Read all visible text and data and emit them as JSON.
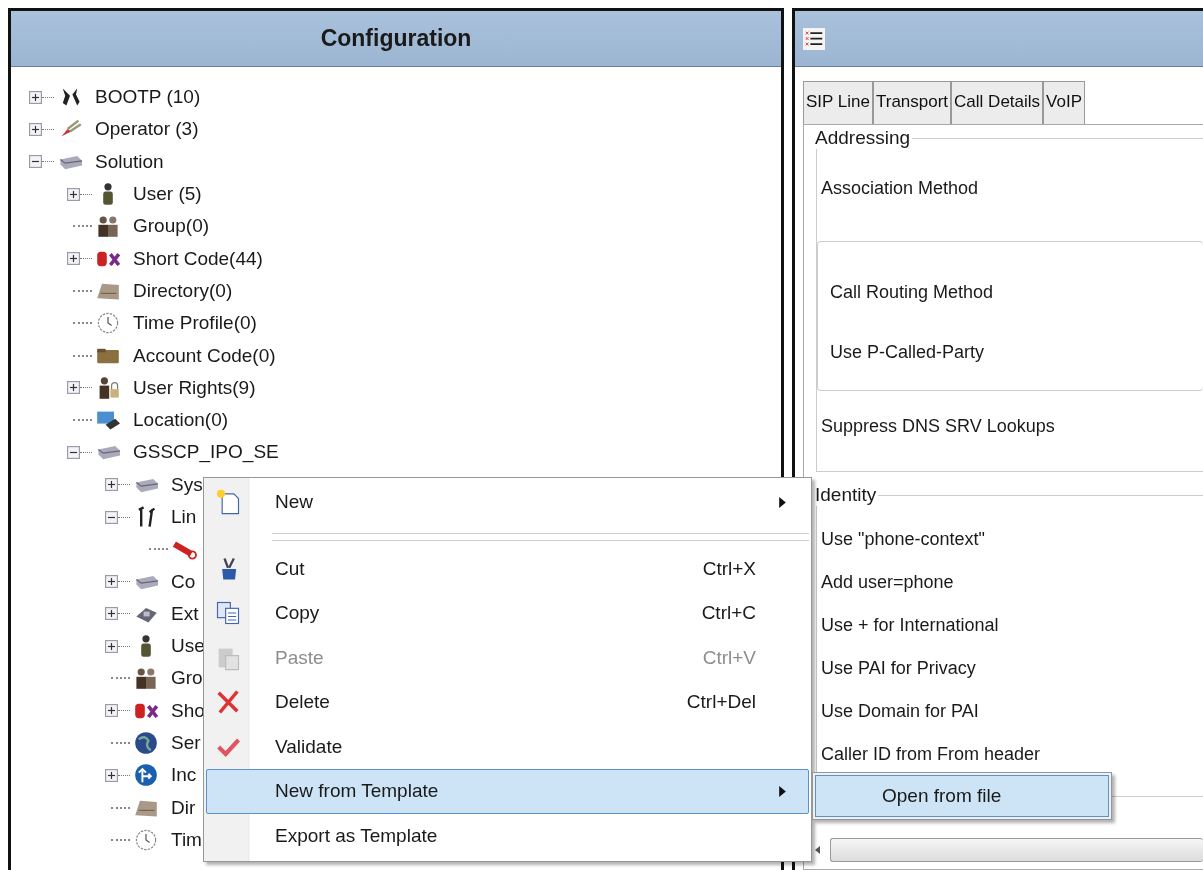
{
  "configuration": {
    "title": "Configuration",
    "tree": [
      {
        "label": "BOOTP (10)",
        "kind": "bootp",
        "expandable": true,
        "expanded": false
      },
      {
        "label": "Operator (3)",
        "kind": "operator",
        "expandable": true,
        "expanded": false
      },
      {
        "label": "Solution",
        "kind": "device",
        "expandable": true,
        "expanded": true,
        "children": [
          {
            "label": "User (5)",
            "kind": "user",
            "expandable": true,
            "expanded": false
          },
          {
            "label": "Group(0)",
            "kind": "group",
            "expandable": false
          },
          {
            "label": "Short Code(44)",
            "kind": "shortcode",
            "expandable": true,
            "expanded": false
          },
          {
            "label": "Directory(0)",
            "kind": "directory",
            "expandable": false
          },
          {
            "label": "Time Profile(0)",
            "kind": "clock",
            "expandable": false
          },
          {
            "label": "Account Code(0)",
            "kind": "account",
            "expandable": false
          },
          {
            "label": "User Rights(9)",
            "kind": "rights",
            "expandable": true,
            "expanded": false
          },
          {
            "label": "Location(0)",
            "kind": "location",
            "expandable": false
          },
          {
            "label": "GSSCP_IPO_SE",
            "kind": "device",
            "expandable": true,
            "expanded": true,
            "children": [
              {
                "label": "Sys",
                "kind": "device",
                "expandable": true,
                "expanded": false
              },
              {
                "label": "Lin",
                "kind": "line",
                "expandable": true,
                "expanded": true,
                "children": [
                  {
                    "kind": "plug",
                    "expandable": false
                  }
                ]
              },
              {
                "label": "Co",
                "kind": "device",
                "expandable": true,
                "expanded": false
              },
              {
                "label": "Ext",
                "kind": "phone",
                "expandable": true,
                "expanded": false
              },
              {
                "label": "Use",
                "kind": "user",
                "expandable": true,
                "expanded": false
              },
              {
                "label": "Gro",
                "kind": "group",
                "expandable": false
              },
              {
                "label": "Sho",
                "kind": "shortcode",
                "expandable": true,
                "expanded": false
              },
              {
                "label": "Ser",
                "kind": "globe",
                "expandable": false
              },
              {
                "label": "Inc",
                "kind": "route",
                "expandable": true,
                "expanded": false
              },
              {
                "label": "Dir",
                "kind": "directory",
                "expandable": false
              },
              {
                "label": "Tim",
                "kind": "clock",
                "expandable": false
              }
            ]
          }
        ]
      }
    ]
  },
  "details": {
    "tabs": [
      "SIP Line",
      "Transport",
      "Call Details",
      "VoIP"
    ],
    "sections": [
      {
        "title": "Addressing",
        "items": [
          {
            "kind": "label",
            "label": "Association Method"
          },
          {
            "kind": "box",
            "items": [
              "Call Routing Method",
              "Use P-Called-Party"
            ]
          },
          {
            "kind": "label",
            "label": "Suppress DNS SRV Lookups"
          }
        ]
      },
      {
        "title": "Identity",
        "items": [
          {
            "kind": "label",
            "label": "Use \"phone-context\""
          },
          {
            "kind": "label",
            "label": "Add user=phone"
          },
          {
            "kind": "label",
            "label": "Use + for International"
          },
          {
            "kind": "label",
            "label": "Use PAI for Privacy"
          },
          {
            "kind": "label",
            "label": "Use Domain for PAI"
          },
          {
            "kind": "label",
            "label": "Caller ID from From header"
          }
        ]
      }
    ]
  },
  "context_menu": {
    "items": [
      {
        "kind": "new",
        "label": "New",
        "submenu": true,
        "disabled": false,
        "selected": false
      },
      {
        "kind": "separator"
      },
      {
        "kind": "cut",
        "label": "Cut",
        "shortcut": "Ctrl+X",
        "submenu": false,
        "disabled": false,
        "selected": false
      },
      {
        "kind": "copy",
        "label": "Copy",
        "shortcut": "Ctrl+C",
        "submenu": false,
        "disabled": false,
        "selected": false
      },
      {
        "kind": "paste",
        "label": "Paste",
        "shortcut": "Ctrl+V",
        "submenu": false,
        "disabled": true,
        "selected": false
      },
      {
        "kind": "delete",
        "label": "Delete",
        "shortcut": "Ctrl+Del",
        "submenu": false,
        "disabled": false,
        "selected": false
      },
      {
        "kind": "validate",
        "label": "Validate",
        "submenu": false,
        "disabled": false,
        "selected": false
      },
      {
        "kind": "plain",
        "label": "New from Template",
        "submenu": true,
        "disabled": false,
        "selected": true
      },
      {
        "kind": "plain",
        "label": "Export as Template",
        "submenu": false,
        "disabled": false,
        "selected": false
      }
    ]
  },
  "submenu": {
    "items": [
      {
        "label": "Open from file",
        "selected": true
      }
    ]
  }
}
